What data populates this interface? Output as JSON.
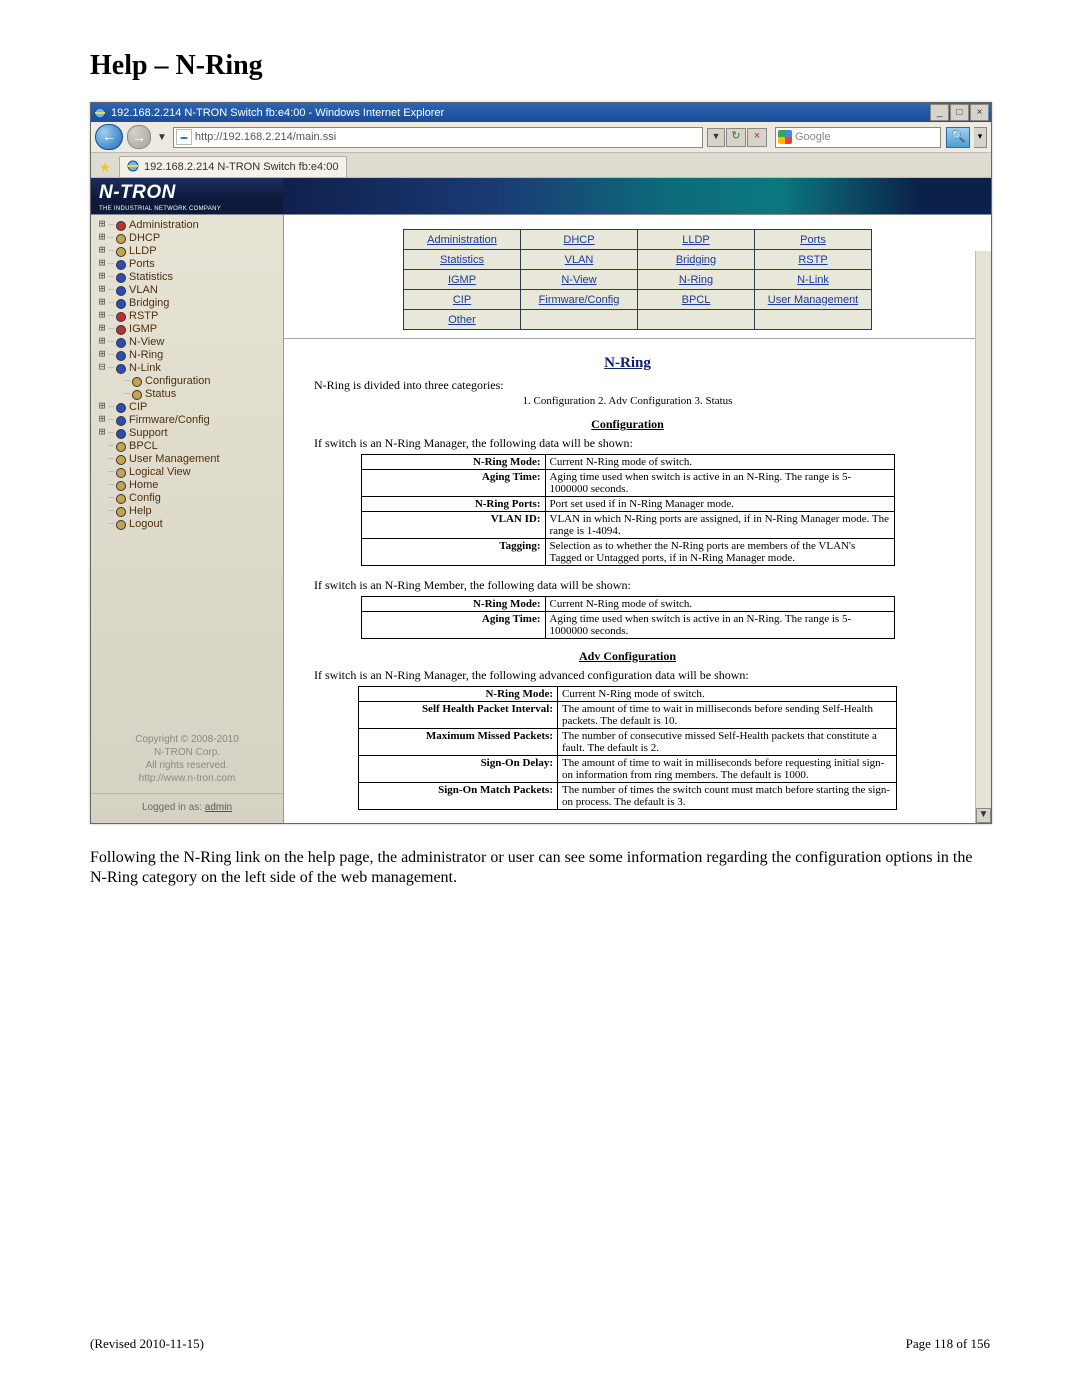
{
  "page": {
    "heading": "Help – N-Ring",
    "body_text": "Following the N-Ring link on the help page, the administrator or user can see some information regarding the configuration options in the N-Ring category on the left side of the web management.",
    "footer_left": "(Revised 2010-11-15)",
    "footer_right": "Page 118 of 156"
  },
  "browser": {
    "window_title": "192.168.2.214 N-TRON Switch fb:e4:00 - Windows Internet Explorer",
    "url": "http://192.168.2.214/main.ssi",
    "search_placeholder": "Google",
    "tab_title": "192.168.2.214 N-TRON Switch fb:e4:00"
  },
  "logo": {
    "name": "N-TRON",
    "sub": "THE INDUSTRIAL NETWORK COMPANY"
  },
  "sidebar": {
    "items": [
      {
        "tw": "+",
        "dot": "red",
        "label": "Administration"
      },
      {
        "tw": "+",
        "dot": "tan",
        "label": "DHCP"
      },
      {
        "tw": "+",
        "dot": "tan",
        "label": "LLDP"
      },
      {
        "tw": "+",
        "dot": "blue",
        "label": "Ports"
      },
      {
        "tw": "+",
        "dot": "blue",
        "label": "Statistics"
      },
      {
        "tw": "+",
        "dot": "blue",
        "label": "VLAN"
      },
      {
        "tw": "+",
        "dot": "blue",
        "label": "Bridging"
      },
      {
        "tw": "+",
        "dot": "red",
        "label": "RSTP"
      },
      {
        "tw": "+",
        "dot": "red",
        "label": "IGMP"
      },
      {
        "tw": "+",
        "dot": "blue",
        "label": "N-View"
      },
      {
        "tw": "+",
        "dot": "blue",
        "label": "N-Ring"
      },
      {
        "tw": "-",
        "dot": "blue",
        "label": "N-Link"
      },
      {
        "tw": " ",
        "dot": "tan",
        "label": "Configuration",
        "indent": 1
      },
      {
        "tw": " ",
        "dot": "tan",
        "label": "Status",
        "indent": 1
      },
      {
        "tw": "+",
        "dot": "blue",
        "label": "CIP"
      },
      {
        "tw": "+",
        "dot": "blue",
        "label": "Firmware/Config"
      },
      {
        "tw": "+",
        "dot": "blue",
        "label": "Support"
      },
      {
        "tw": " ",
        "dot": "tan",
        "label": "BPCL"
      },
      {
        "tw": " ",
        "dot": "tan",
        "label": "User Management"
      },
      {
        "tw": " ",
        "dot": "tan",
        "label": "Logical View"
      },
      {
        "tw": " ",
        "dot": "tan",
        "label": "Home"
      },
      {
        "tw": " ",
        "dot": "tan",
        "label": "Config"
      },
      {
        "tw": " ",
        "dot": "tan",
        "label": "Help"
      },
      {
        "tw": " ",
        "dot": "tan",
        "label": "Logout"
      }
    ],
    "copyright_l1": "Copyright © 2008-2010",
    "copyright_l2": "N-TRON Corp.",
    "copyright_l3": "All rights reserved.",
    "copyright_l4": "http://www.n-tron.com",
    "logged_in_prefix": "Logged in as: ",
    "logged_in_user": "admin"
  },
  "linkgrid": {
    "rows": [
      [
        "Administration",
        "DHCP",
        "LLDP",
        "Ports"
      ],
      [
        "Statistics",
        "VLAN",
        "Bridging",
        "RSTP"
      ],
      [
        "IGMP",
        "N-View",
        "N-Ring",
        "N-Link"
      ],
      [
        "CIP",
        "Firmware/Config",
        "BPCL",
        "User Management"
      ],
      [
        "Other",
        "",
        "",
        ""
      ]
    ]
  },
  "help": {
    "title": "N-Ring",
    "intro": "N-Ring is divided into three categories:",
    "intro_sub": "1. Configuration   2. Adv Configuration   3. Status",
    "cfg_header": "Configuration",
    "cfg_note_mgr": "If switch is an N-Ring Manager, the following data will be shown:",
    "cfg_mgr_rows": [
      {
        "k": "N-Ring Mode:",
        "v": "Current N-Ring mode of switch."
      },
      {
        "k": "Aging Time:",
        "v": "Aging time used when switch is active in an N-Ring. The range is 5-1000000 seconds."
      },
      {
        "k": "N-Ring Ports:",
        "v": "Port set used if in N-Ring Manager mode."
      },
      {
        "k": "VLAN ID:",
        "v": "VLAN in which N-Ring ports are assigned, if in N-Ring Manager mode. The range is 1-4094."
      },
      {
        "k": "Tagging:",
        "v": "Selection as to whether the N-Ring ports are members of the VLAN's Tagged or Untagged ports, if in N-Ring Manager mode."
      }
    ],
    "cfg_note_mem": "If switch is an N-Ring Member, the following data will be shown:",
    "cfg_mem_rows": [
      {
        "k": "N-Ring Mode:",
        "v": "Current N-Ring mode of switch."
      },
      {
        "k": "Aging Time:",
        "v": "Aging time used when switch is active in an N-Ring. The range is 5-1000000 seconds."
      }
    ],
    "adv_header": "Adv Configuration",
    "adv_note": "If switch is an N-Ring Manager, the following advanced configuration data will be shown:",
    "adv_rows": [
      {
        "k": "N-Ring Mode:",
        "v": "Current N-Ring mode of switch."
      },
      {
        "k": "Self Health Packet Interval:",
        "v": "The amount of time to wait in milliseconds before sending Self-Health packets. The default is 10."
      },
      {
        "k": "Maximum Missed Packets:",
        "v": "The number of consecutive missed Self-Health packets that constitute a fault. The default is 2."
      },
      {
        "k": "Sign-On Delay:",
        "v": "The amount of time to wait in milliseconds before requesting initial sign-on information from ring members. The default is 1000."
      },
      {
        "k": "Sign-On Match Packets:",
        "v": "The number of times the switch count must match before starting the sign-on process. The default is 3."
      }
    ]
  }
}
